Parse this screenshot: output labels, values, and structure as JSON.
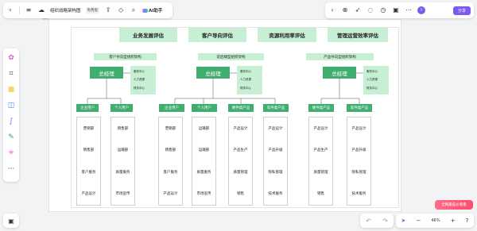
{
  "toolbar": {
    "back_icon": "chevron-left-icon",
    "menu_icon": "menu-icon",
    "doc_title": "组织战略架构图",
    "doc_badge": "免费版",
    "ai_label": "AI助手"
  },
  "right_toolbar": {
    "avatar_letter": "I",
    "share_label": "分享"
  },
  "sheet": {
    "label": "画板"
  },
  "top_boxes": [
    "业务发展评估",
    "客户导向评估",
    "资源利用率评估",
    "管理运营效率评估"
  ],
  "groups": [
    {
      "header": "客户导向型组织架构",
      "manager": "总经理",
      "side": [
        "服务中心",
        "人力资源",
        "财务中心"
      ],
      "subs": [
        "企业用户",
        "个人用户"
      ],
      "columns": [
        [
          "营销部",
          "销售部",
          "客户服务",
          "产品设计"
        ],
        [
          "销售部",
          "运输部",
          "质量服务",
          "市场宣传"
        ]
      ]
    },
    {
      "header": "前后端型组织架构",
      "manager": "总经理",
      "side": [
        "服务中心",
        "人力资源",
        "财务中心"
      ],
      "subs": [
        "企业用户",
        "个人用户",
        "硬件类产品",
        "软件类产品"
      ],
      "columns": [
        [
          "营销部",
          "销售部",
          "客户服务",
          "产品设计"
        ],
        [
          "运输部",
          "运输部",
          "质量服务",
          "市场宣传"
        ],
        [
          "产品设计",
          "产品生产",
          "质量管理",
          "销售"
        ],
        [
          "产品设计",
          "产品升级",
          "隐私管理",
          "技术服务"
        ]
      ]
    },
    {
      "header": "产品导向型组织架构",
      "manager": "总经理",
      "side": [
        "服务中心",
        "人力资源",
        "财务中心"
      ],
      "subs": [
        "硬件类产品",
        "软件类产品"
      ],
      "columns": [
        [
          "产品设计",
          "产品生产",
          "质量管理",
          "销售"
        ],
        [
          "产品设计",
          "产品升级",
          "隐私管理",
          "技术服务"
        ]
      ]
    }
  ],
  "bottom": {
    "zoom": "46%",
    "promo": "全网最低价看看"
  },
  "colors": {
    "light_green": "#c6efd4",
    "dark_green": "#3fae6e",
    "accent": "#7a5cf0"
  }
}
